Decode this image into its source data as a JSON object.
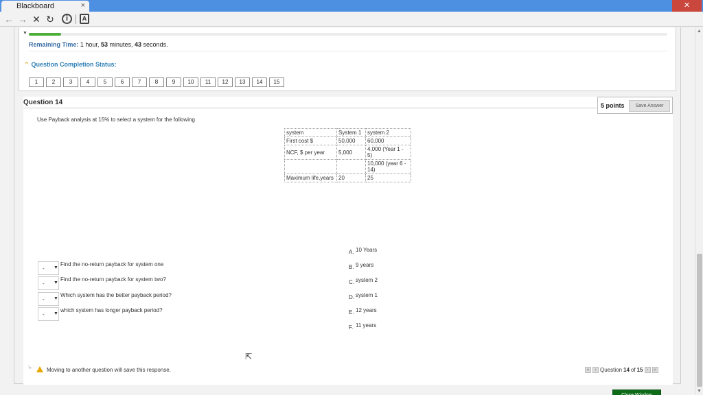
{
  "browser": {
    "tab_title": "Blackboard",
    "tab_close": "×",
    "window_close": "✕"
  },
  "test": {
    "progress_percent": 5,
    "remaining_label": "Remaining Time:",
    "hours": "1",
    "hour_word": "hour,",
    "minutes": "53",
    "minute_word": "minutes,",
    "seconds": "43",
    "second_word": "seconds.",
    "status_label": "Question Completion Status:",
    "question_numbers": [
      "1",
      "2",
      "3",
      "4",
      "5",
      "6",
      "7",
      "8",
      "9",
      "10",
      "11",
      "12",
      "13",
      "14",
      "15"
    ]
  },
  "question": {
    "title": "Question 14",
    "points": "5 points",
    "save_label": "Save Answer",
    "text": "Use Payback analysis at 15% to select a system for the following",
    "table": [
      [
        "system",
        "System 1",
        "system 2"
      ],
      [
        "First cost $",
        "50,000",
        "60,000"
      ],
      [
        "NCF, $ per year",
        "5,000",
        "4,000 (Year 1 - 5)"
      ],
      [
        "",
        "",
        "10,000 (year 6 - 14)"
      ],
      [
        "Maximum life,years",
        "20",
        "25"
      ]
    ],
    "prompts": [
      {
        "selected": "-",
        "text": "Find the no-return payback for system one"
      },
      {
        "selected": "-",
        "text": "Find the no-return payback for system two?"
      },
      {
        "selected": "-",
        "text": "Which system has the better payback period?"
      },
      {
        "selected": "-",
        "text": "which system has longer payback period?"
      }
    ],
    "answers": [
      {
        "letter": "A.",
        "text": "10 Years"
      },
      {
        "letter": "B.",
        "text": "9 years"
      },
      {
        "letter": "C.",
        "text": "system 2"
      },
      {
        "letter": "D.",
        "text": "system 1"
      },
      {
        "letter": "E.",
        "text": "12 years"
      },
      {
        "letter": "F.",
        "text": "11 years"
      }
    ]
  },
  "footer": {
    "warning": "Moving to another question will save this response.",
    "nav_prefix": "Question",
    "current": "14",
    "of": "of",
    "total": "15",
    "close_label": "Close Window"
  }
}
